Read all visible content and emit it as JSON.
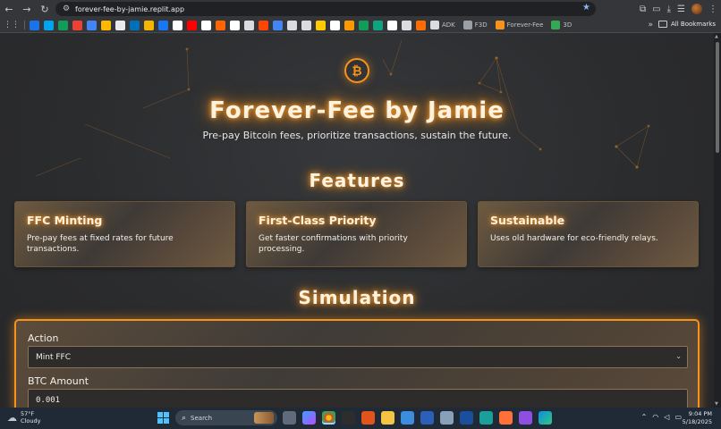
{
  "browser": {
    "url": "forever-fee-by-jamie.replit.app",
    "bookmarks_labeled": [
      {
        "label": "ADK",
        "color": "#dadce0"
      },
      {
        "label": "F3D",
        "color": "#9aa0a6"
      },
      {
        "label": "Forever-Fee",
        "color": "#f7931a"
      },
      {
        "label": "3D",
        "color": "#34a853"
      }
    ],
    "all_bookmarks_label": "All Bookmarks",
    "bookmark_icon_colors": [
      "#1a73e8",
      "#00a4ef",
      "#0f9d58",
      "#ea4335",
      "#4285f4",
      "#ffba00",
      "#e8eaed",
      "#0070ba",
      "#f4b400",
      "#1877f2",
      "#ffffff",
      "#ff0000",
      "#ffffff",
      "#ff6600",
      "#ffffff",
      "#dadce0",
      "#ff4500",
      "#4285f4",
      "#dadce0",
      "#dadce0",
      "#ffcc00",
      "#ffffff",
      "#ff9900",
      "#0f9d58",
      "#10a37f",
      "#ffffff",
      "#dadce0",
      "#ff6d00"
    ]
  },
  "page": {
    "logo_symbol": "₿",
    "title": "Forever-Fee by Jamie",
    "tagline": "Pre-pay Bitcoin fees, prioritize transactions, sustain the future.",
    "features_heading": "Features",
    "features": [
      {
        "title": "FFC Minting",
        "text": "Pre-pay fees at fixed rates for future transactions."
      },
      {
        "title": "First-Class Priority",
        "text": "Get faster confirmations with priority processing."
      },
      {
        "title": "Sustainable",
        "text": "Uses old hardware for eco-friendly relays."
      }
    ],
    "simulation_heading": "Simulation",
    "simulation": {
      "action_label": "Action",
      "action_value": "Mint FFC",
      "btc_label": "BTC Amount",
      "btc_value": "0.001"
    },
    "accent_color": "#f7931a"
  },
  "taskbar": {
    "weather_temp": "57°F",
    "weather_cond": "Cloudy",
    "search_placeholder": "Search",
    "time": "9:04 PM",
    "date": "5/18/2025"
  }
}
